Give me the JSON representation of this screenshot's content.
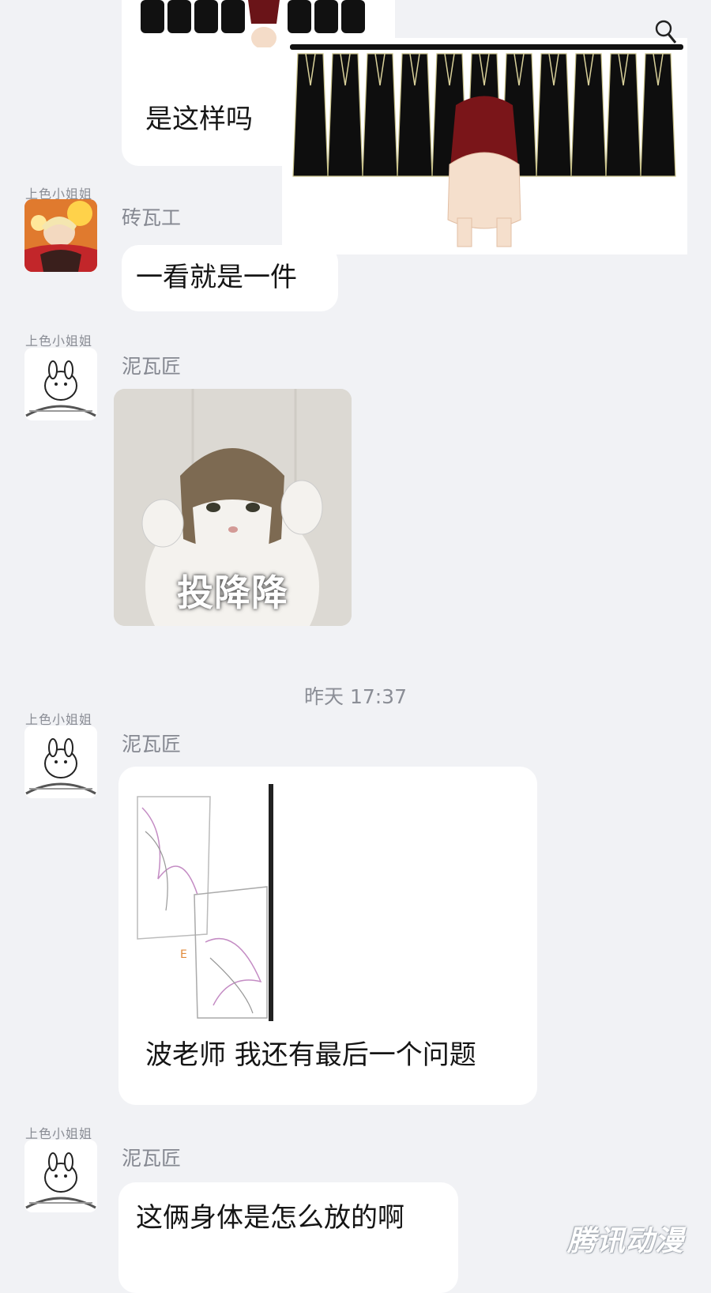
{
  "messages": [
    {
      "text": "是这样吗"
    },
    {
      "badge": "上色小姐姐",
      "sender": "砖瓦工",
      "text": "一看就是一件"
    },
    {
      "badge": "上色小姐姐",
      "sender": "泥瓦匠",
      "sticker_caption": "投降降"
    },
    {
      "badge": "上色小姐姐",
      "sender": "泥瓦匠",
      "text": "波老师 我还有最后一个问题"
    },
    {
      "badge": "上色小姐姐",
      "sender": "泥瓦匠",
      "text": "这俩身体是怎么放的啊"
    }
  ],
  "timestamp": "昨天 17:37",
  "watermark": "腾讯动漫",
  "icons": {
    "zoom": "magnifier-icon",
    "avatar_1": "anime-avatar-icon",
    "avatar_2": "rabbit-avatar-icon"
  },
  "colors": {
    "background": "#f1f2f5",
    "bubble": "#ffffff",
    "secondary_text": "#858891"
  }
}
